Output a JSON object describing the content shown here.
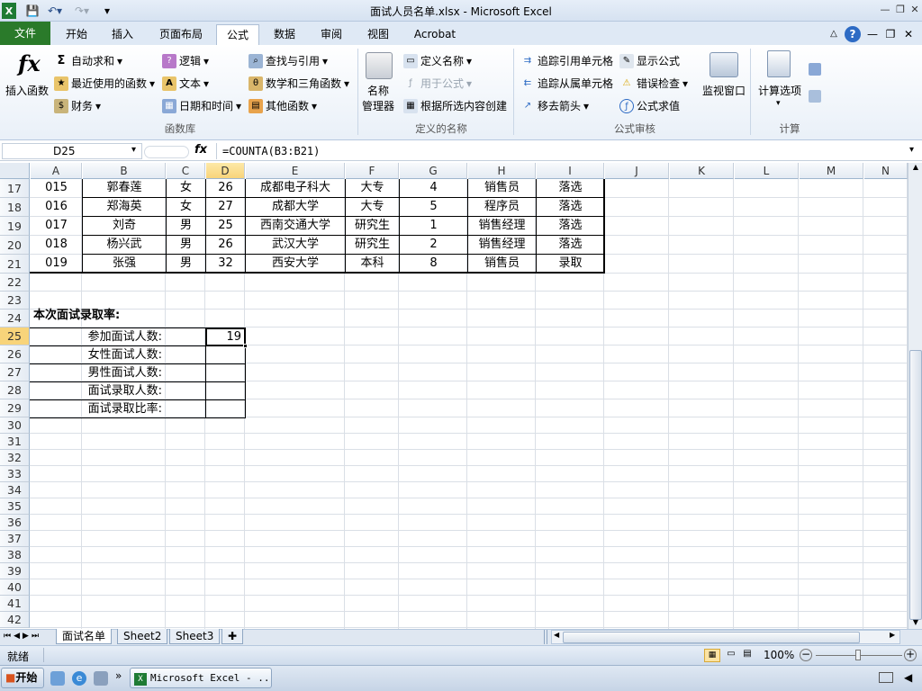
{
  "window": {
    "title": "面试人员名单.xlsx - Microsoft Excel"
  },
  "tabs": [
    "文件",
    "开始",
    "插入",
    "页面布局",
    "公式",
    "数据",
    "审阅",
    "视图",
    "Acrobat"
  ],
  "ribbon": {
    "insert_fn": "插入函数",
    "autosum": "自动求和",
    "recent": "最近使用的函数",
    "finance": "财务",
    "logic": "逻辑",
    "text": "文本",
    "datetime": "日期和时间",
    "lookup": "查找与引用",
    "math": "数学和三角函数",
    "other": "其他函数",
    "fnlib_label": "函数库",
    "name_mgr_1": "名称",
    "name_mgr_2": "管理器",
    "define_name": "定义名称",
    "use_in_formula": "用于公式",
    "create_from_sel": "根据所选内容创建",
    "defnames_label": "定义的名称",
    "trace_prec": "追踪引用单元格",
    "trace_dep": "追踪从属单元格",
    "remove_arrows": "移去箭头",
    "show_formulas": "显示公式",
    "error_check": "错误检查",
    "eval_formula": "公式求值",
    "watch": "监视窗口",
    "audit_label": "公式审核",
    "calc_options": "计算选项",
    "calc_label": "计算"
  },
  "formula_bar": {
    "name_box": "D25",
    "fx": "fx",
    "formula": "=COUNTA(B3:B21)"
  },
  "columns": [
    "A",
    "B",
    "C",
    "D",
    "E",
    "F",
    "G",
    "H",
    "I",
    "J",
    "K",
    "L",
    "M",
    "N"
  ],
  "rows": [
    "17",
    "18",
    "19",
    "20",
    "21",
    "22",
    "23",
    "24",
    "25",
    "26",
    "27",
    "28",
    "29",
    "30",
    "31",
    "32",
    "33",
    "34",
    "35",
    "36",
    "37",
    "38",
    "39",
    "40",
    "41",
    "42"
  ],
  "table_rows": [
    [
      "015",
      "郭春莲",
      "女",
      "26",
      "成都电子科大",
      "大专",
      "4",
      "销售员",
      "落选"
    ],
    [
      "016",
      "郑海英",
      "女",
      "27",
      "成都大学",
      "大专",
      "5",
      "程序员",
      "落选"
    ],
    [
      "017",
      "刘奇",
      "男",
      "25",
      "西南交通大学",
      "研究生",
      "1",
      "销售经理",
      "落选"
    ],
    [
      "018",
      "杨兴武",
      "男",
      "26",
      "武汉大学",
      "研究生",
      "2",
      "销售经理",
      "落选"
    ],
    [
      "019",
      "张强",
      "男",
      "32",
      "西安大学",
      "本科",
      "8",
      "销售员",
      "录取"
    ]
  ],
  "summary": {
    "heading": "本次面试录取率:",
    "labels": [
      "参加面试人数:",
      "女性面试人数:",
      "男性面试人数:",
      "面试录取人数:",
      "面试录取比率:"
    ],
    "d25_value": "19"
  },
  "sheets": [
    "面试名单",
    "Sheet2",
    "Sheet3"
  ],
  "status": {
    "ready": "就绪",
    "zoom": "100%"
  },
  "taskbar": {
    "start": "开始",
    "task": "Microsoft Excel - ..."
  }
}
